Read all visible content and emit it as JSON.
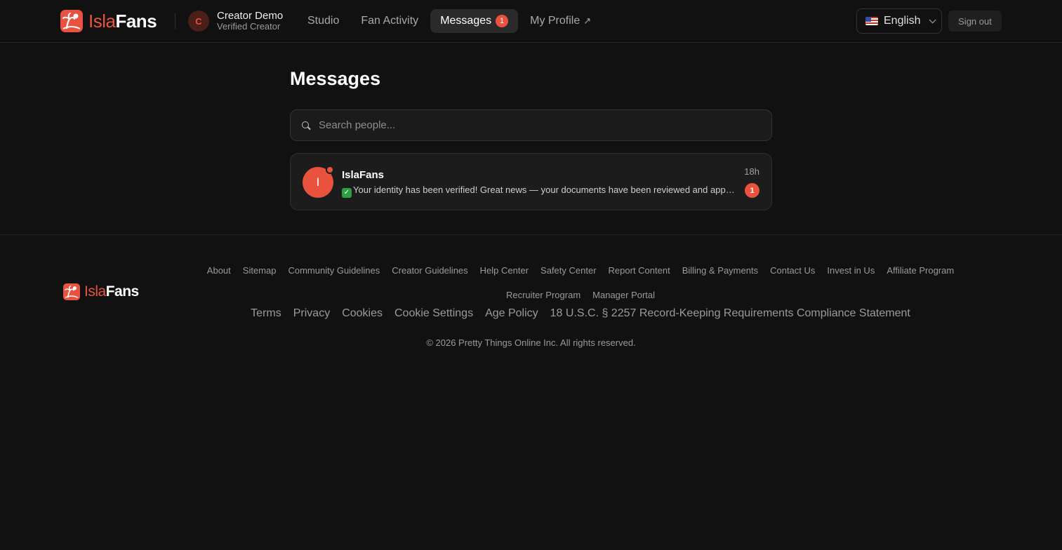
{
  "header": {
    "logo": {
      "part1": "Isla",
      "part2": "Fans"
    },
    "creator": {
      "initial": "C",
      "name": "Creator Demo",
      "role": "Verified Creator"
    },
    "nav": [
      {
        "label": "Studio"
      },
      {
        "label": "Fan Activity"
      },
      {
        "label": "Messages",
        "badge": "1",
        "active": true
      },
      {
        "label": "My Profile",
        "icon": "↗"
      }
    ],
    "language": {
      "label": "English",
      "flag": "us-flag-icon"
    },
    "signout_label": "Sign out"
  },
  "main": {
    "title": "Messages",
    "search": {
      "placeholder": "Search people..."
    },
    "conversations": [
      {
        "initial": "I",
        "name": "IslaFans",
        "time": "18h",
        "preview_icon": "✓",
        "preview": "Your identity has been verified! Great news — your documents have been reviewed and approved.",
        "unread": "1",
        "online": true
      }
    ]
  },
  "footer": {
    "logo": {
      "part1": "Isla",
      "part2": "Fans"
    },
    "links_row1": [
      "About",
      "Sitemap",
      "Community Guidelines",
      "Creator Guidelines",
      "Help Center",
      "Safety Center",
      "Report Content",
      "Billing & Payments",
      "Contact Us",
      "Invest in Us",
      "Affiliate Program"
    ],
    "links_row2": [
      "Recruiter Program",
      "Manager Portal"
    ],
    "legal": [
      "Terms",
      "Privacy",
      "Cookies",
      "Cookie Settings",
      "Age Policy",
      "18 U.S.C. § 2257 Record-Keeping Requirements Compliance Statement"
    ],
    "copyright": "© 2026 Pretty Things Online Inc. All rights reserved."
  },
  "colors": {
    "accent": "#e9523f",
    "background": "#111111",
    "card": "#1c1c1c",
    "verified_green": "#2e9e45"
  }
}
